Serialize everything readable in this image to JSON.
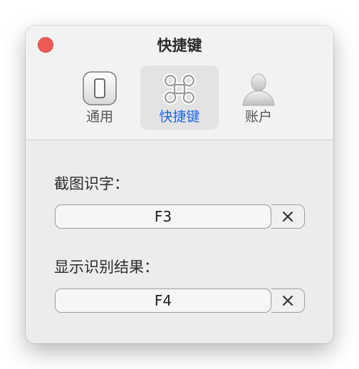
{
  "window": {
    "title": "快捷键"
  },
  "toolbar": {
    "tabs": [
      {
        "label": "通用",
        "icon": "general-icon"
      },
      {
        "label": "快捷键",
        "icon": "command-icon"
      },
      {
        "label": "账户",
        "icon": "account-icon"
      }
    ],
    "active_tab": "快捷键"
  },
  "shortcuts": [
    {
      "label": "截图识字：",
      "value": "F3",
      "clear_icon": "clear-icon"
    },
    {
      "label": "显示识别结果：",
      "value": "F4",
      "clear_icon": "clear-icon"
    }
  ],
  "colors": {
    "accent": "#1b66e4",
    "close_button": "#ee5b56"
  }
}
